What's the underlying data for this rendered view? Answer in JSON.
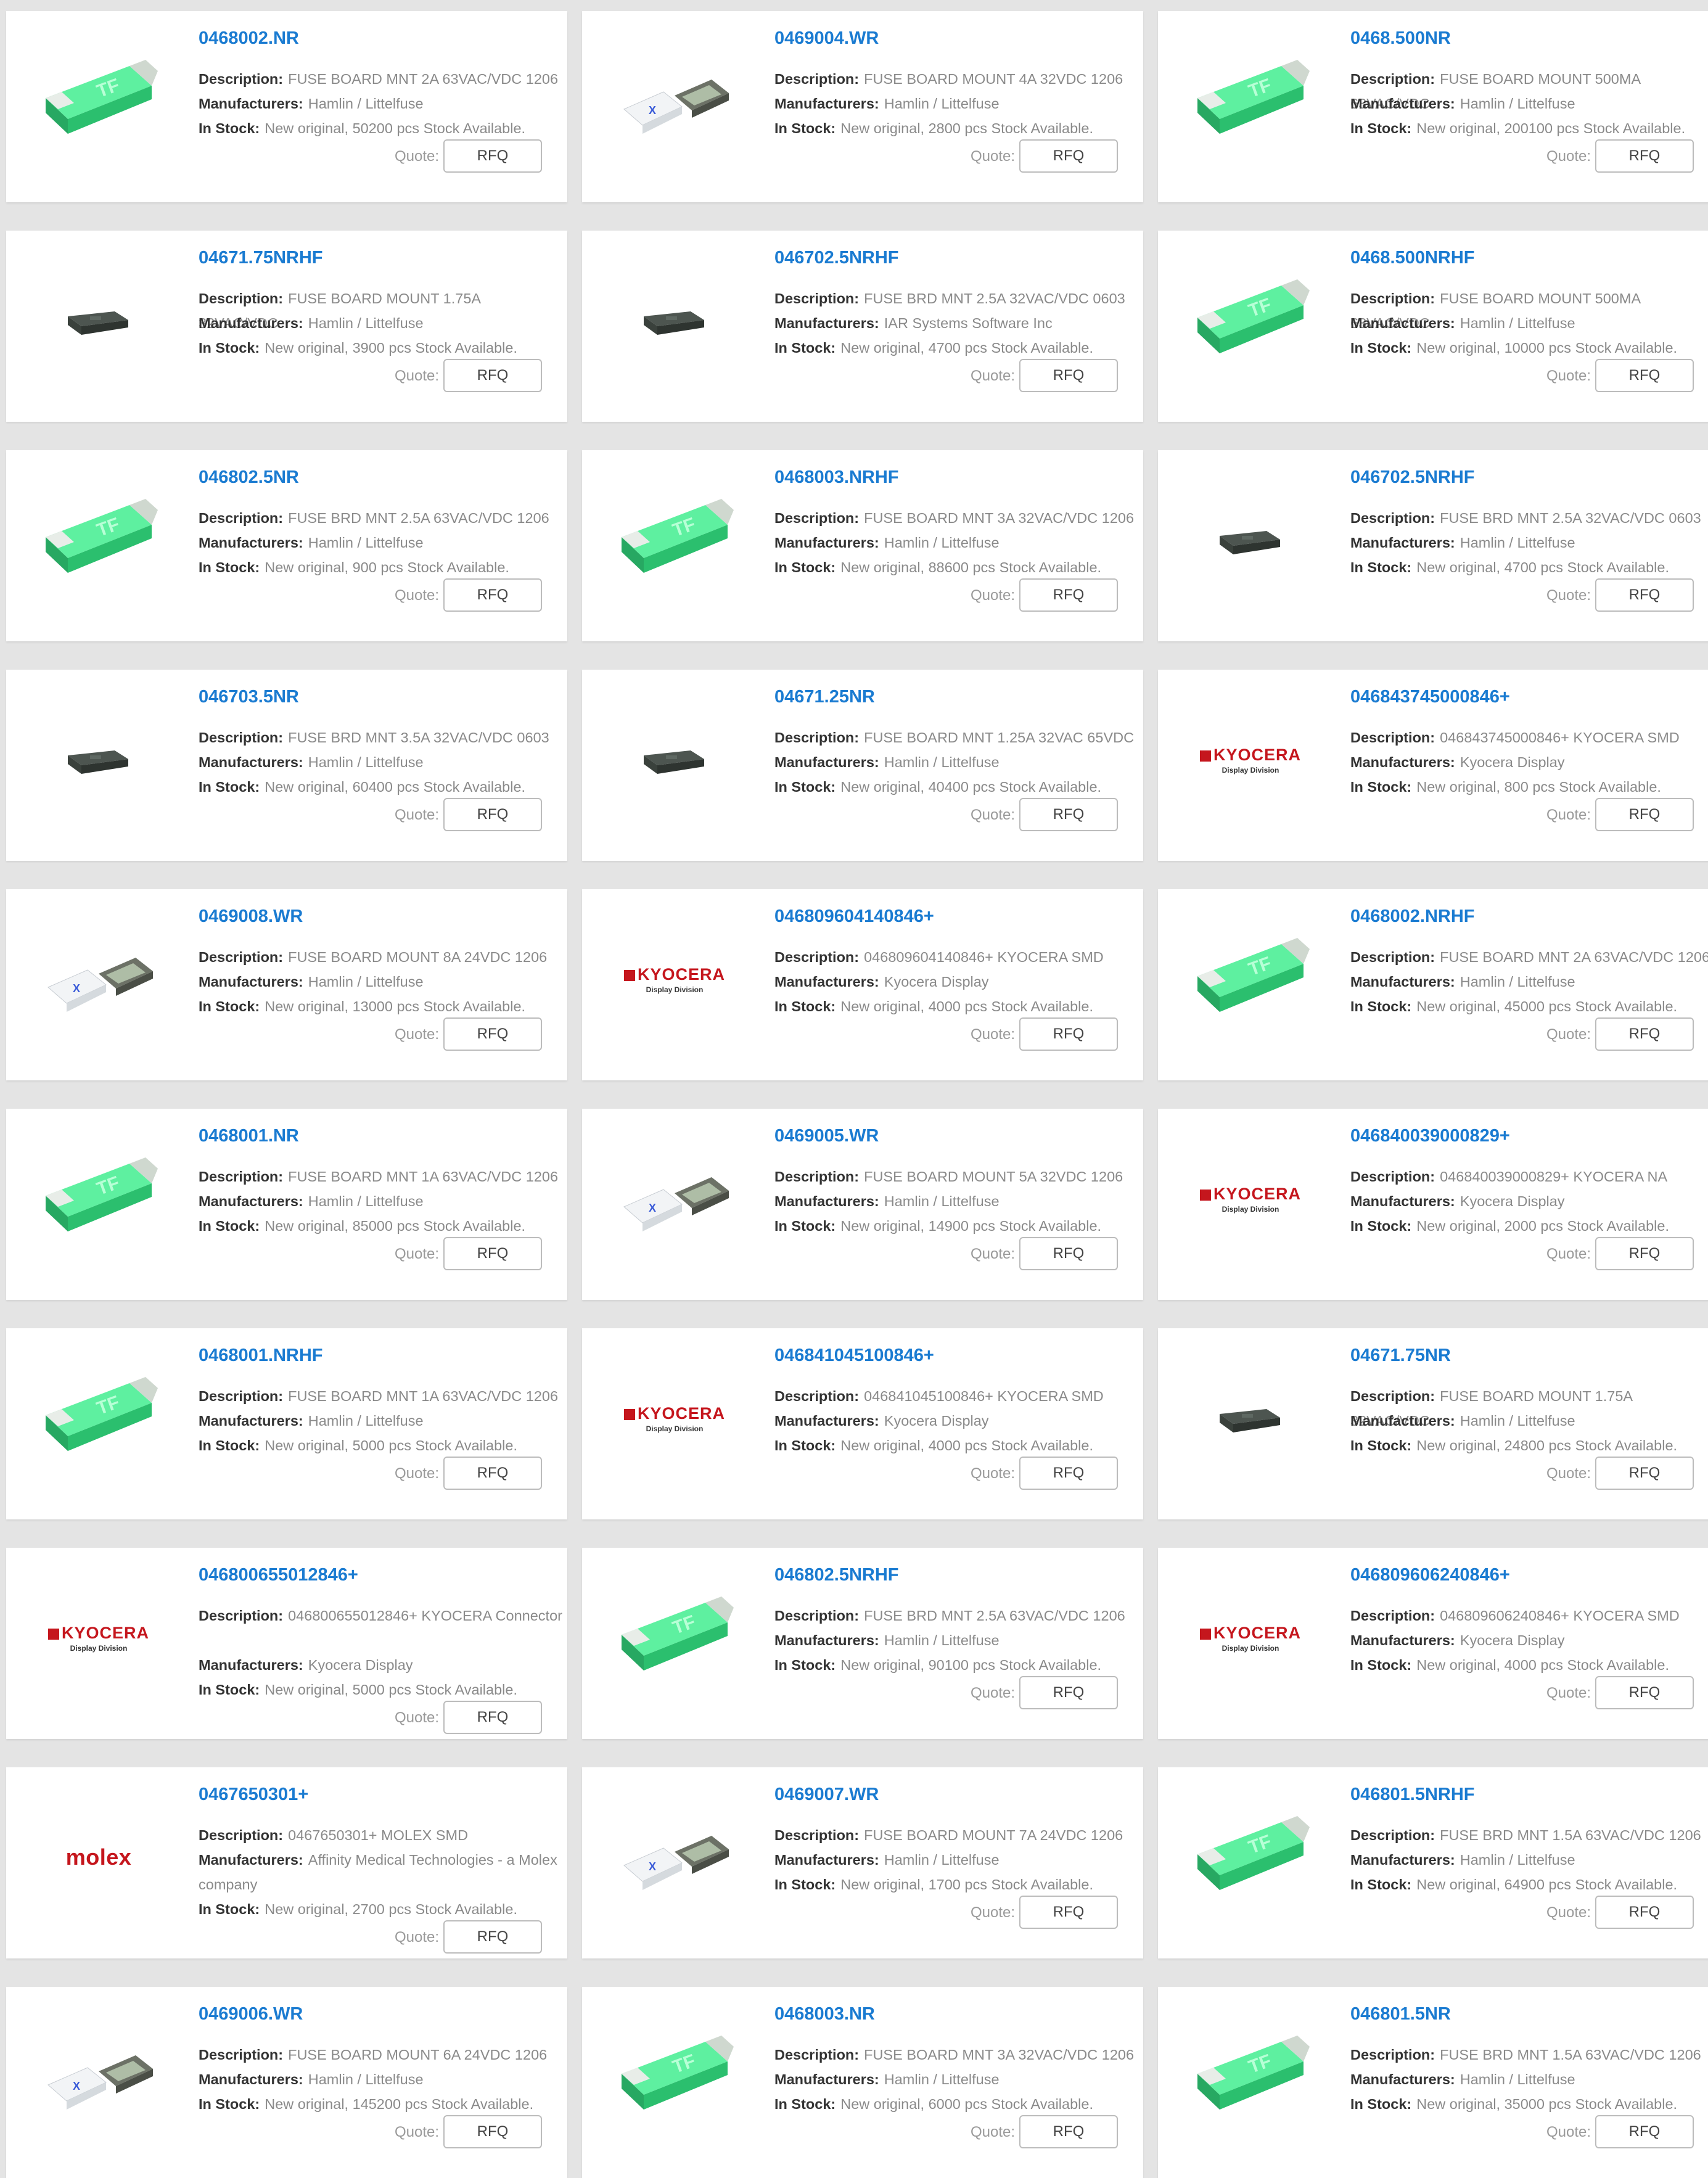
{
  "labels": {
    "description": "Description:",
    "manufacturers": "Manufacturers:",
    "in_stock": "In Stock:",
    "quote": "Quote:",
    "rfq": "RFQ"
  },
  "products": [
    {
      "pn": "0468002.NR",
      "desc": "FUSE BOARD MNT 2A 63VAC/VDC 1206",
      "mfr": "Hamlin / Littelfuse",
      "stock": "New original, 50200 pcs Stock Available.",
      "image": "green-fuse-image"
    },
    {
      "pn": "0469004.WR",
      "desc": "FUSE BOARD MOUNT 4A 32VDC 1206",
      "mfr": "Hamlin / Littelfuse",
      "stock": "New original, 2800 pcs Stock Available.",
      "image": "white-chip-fuse-image"
    },
    {
      "pn": "0468.500NR",
      "desc": "FUSE BOARD MOUNT 500MA 63VAC/VDC",
      "mfr": "Hamlin / Littelfuse",
      "stock": "New original, 200100 pcs Stock Available.",
      "image": "green-fuse-image"
    },
    {
      "pn": "04671.75NRHF",
      "desc": "FUSE BOARD MOUNT 1.75A 32VAC/VDC",
      "mfr": "Hamlin / Littelfuse",
      "stock": "New original, 3900 pcs Stock Available.",
      "image": "dark-chip-image"
    },
    {
      "pn": "046702.5NRHF",
      "desc": "FUSE BRD MNT 2.5A 32VAC/VDC 0603",
      "mfr": "IAR Systems Software Inc",
      "stock": "New original, 4700 pcs Stock Available.",
      "image": "dark-chip-image"
    },
    {
      "pn": "0468.500NRHF",
      "desc": "FUSE BOARD MOUNT 500MA 63VAC/VDC",
      "mfr": "Hamlin / Littelfuse",
      "stock": "New original, 10000 pcs Stock Available.",
      "image": "green-fuse-image"
    },
    {
      "pn": "046802.5NR",
      "desc": "FUSE BRD MNT 2.5A 63VAC/VDC 1206",
      "mfr": "Hamlin / Littelfuse",
      "stock": "New original, 900 pcs Stock Available.",
      "image": "green-fuse-image"
    },
    {
      "pn": "0468003.NRHF",
      "desc": "FUSE BOARD MNT 3A 32VAC/VDC 1206",
      "mfr": "Hamlin / Littelfuse",
      "stock": "New original, 88600 pcs Stock Available.",
      "image": "green-fuse-image"
    },
    {
      "pn": "046702.5NRHF",
      "desc": "FUSE BRD MNT 2.5A 32VAC/VDC 0603",
      "mfr": "Hamlin / Littelfuse",
      "stock": "New original, 4700 pcs Stock Available.",
      "image": "dark-chip-image"
    },
    {
      "pn": "046703.5NR",
      "desc": "FUSE BRD MNT 3.5A 32VAC/VDC 0603",
      "mfr": "Hamlin / Littelfuse",
      "stock": "New original, 60400 pcs Stock Available.",
      "image": "dark-chip-image"
    },
    {
      "pn": "04671.25NR",
      "desc": "FUSE BOARD MNT 1.25A 32VAC 65VDC",
      "mfr": "Hamlin / Littelfuse",
      "stock": "New original, 40400 pcs Stock Available.",
      "image": "dark-chip-image"
    },
    {
      "pn": "046843745000846+",
      "desc": "046843745000846+ KYOCERA SMD",
      "mfr": "Kyocera Display",
      "stock": "New original, 800 pcs Stock Available.",
      "image": "kyocera-logo"
    },
    {
      "pn": "0469008.WR",
      "desc": "FUSE BOARD MOUNT 8A 24VDC 1206",
      "mfr": "Hamlin / Littelfuse",
      "stock": "New original, 13000 pcs Stock Available.",
      "image": "white-chip-fuse-image"
    },
    {
      "pn": "046809604140846+",
      "desc": "046809604140846+ KYOCERA SMD",
      "mfr": "Kyocera Display",
      "stock": "New original, 4000 pcs Stock Available.",
      "image": "kyocera-logo"
    },
    {
      "pn": "0468002.NRHF",
      "desc": "FUSE BOARD MNT 2A 63VAC/VDC 1206",
      "mfr": "Hamlin / Littelfuse",
      "stock": "New original, 45000 pcs Stock Available.",
      "image": "green-fuse-image"
    },
    {
      "pn": "0468001.NR",
      "desc": "FUSE BOARD MNT 1A 63VAC/VDC 1206",
      "mfr": "Hamlin / Littelfuse",
      "stock": "New original, 85000 pcs Stock Available.",
      "image": "green-fuse-image"
    },
    {
      "pn": "0469005.WR",
      "desc": "FUSE BOARD MOUNT 5A 32VDC 1206",
      "mfr": "Hamlin / Littelfuse",
      "stock": "New original, 14900 pcs Stock Available.",
      "image": "white-chip-fuse-image"
    },
    {
      "pn": "046840039000829+",
      "desc": "046840039000829+ KYOCERA NA",
      "mfr": "Kyocera Display",
      "stock": "New original, 2000 pcs Stock Available.",
      "image": "kyocera-logo"
    },
    {
      "pn": "0468001.NRHF",
      "desc": "FUSE BOARD MNT 1A 63VAC/VDC 1206",
      "mfr": "Hamlin / Littelfuse",
      "stock": "New original, 5000 pcs Stock Available.",
      "image": "green-fuse-image"
    },
    {
      "pn": "046841045100846+",
      "desc": "046841045100846+ KYOCERA SMD",
      "mfr": "Kyocera Display",
      "stock": "New original, 4000 pcs Stock Available.",
      "image": "kyocera-logo"
    },
    {
      "pn": "04671.75NR",
      "desc": "FUSE BOARD MOUNT 1.75A 32VAC/VDC",
      "mfr": "Hamlin / Littelfuse",
      "stock": "New original, 24800 pcs Stock Available.",
      "image": "dark-chip-image"
    },
    {
      "pn": "046800655012846+",
      "desc": "046800655012846+ KYOCERA Connector",
      "mfr": "Kyocera Display",
      "stock": "New original, 5000 pcs Stock Available.",
      "image": "kyocera-logo"
    },
    {
      "pn": "046802.5NRHF",
      "desc": "FUSE BRD MNT 2.5A 63VAC/VDC 1206",
      "mfr": "Hamlin / Littelfuse",
      "stock": "New original, 90100 pcs Stock Available.",
      "image": "green-fuse-image"
    },
    {
      "pn": "046809606240846+",
      "desc": "046809606240846+ KYOCERA SMD",
      "mfr": "Kyocera Display",
      "stock": "New original, 4000 pcs Stock Available.",
      "image": "kyocera-logo"
    },
    {
      "pn": "0467650301+",
      "desc": "0467650301+ MOLEX SMD",
      "mfr": "Affinity Medical Technologies - a Molex company",
      "stock": "New original, 2700 pcs Stock Available.",
      "image": "molex-logo"
    },
    {
      "pn": "0469007.WR",
      "desc": "FUSE BOARD MOUNT 7A 24VDC 1206",
      "mfr": "Hamlin / Littelfuse",
      "stock": "New original, 1700 pcs Stock Available.",
      "image": "white-chip-fuse-image"
    },
    {
      "pn": "046801.5NRHF",
      "desc": "FUSE BRD MNT 1.5A 63VAC/VDC 1206",
      "mfr": "Hamlin / Littelfuse",
      "stock": "New original, 64900 pcs Stock Available.",
      "image": "green-fuse-image"
    },
    {
      "pn": "0469006.WR",
      "desc": "FUSE BOARD MOUNT 6A 24VDC 1206",
      "mfr": "Hamlin / Littelfuse",
      "stock": "New original, 145200 pcs Stock Available.",
      "image": "white-chip-fuse-image"
    },
    {
      "pn": "0468003.NR",
      "desc": "FUSE BOARD MNT 3A 32VAC/VDC 1206",
      "mfr": "Hamlin / Littelfuse",
      "stock": "New original, 6000 pcs Stock Available.",
      "image": "green-fuse-image"
    },
    {
      "pn": "046801.5NR",
      "desc": "FUSE BRD MNT 1.5A 63VAC/VDC 1206",
      "mfr": "Hamlin / Littelfuse",
      "stock": "New original, 35000 pcs Stock Available.",
      "image": "green-fuse-image"
    }
  ],
  "logos": {
    "kyocera": {
      "main": "KYOCERA",
      "sub": "Display Division"
    },
    "molex": {
      "main": "molex"
    }
  },
  "colors": {
    "part_number": "#1a7bd1",
    "background": "#e4e4e4",
    "fuse_green": "#3ddc84",
    "brand_red": "#c5161d"
  }
}
